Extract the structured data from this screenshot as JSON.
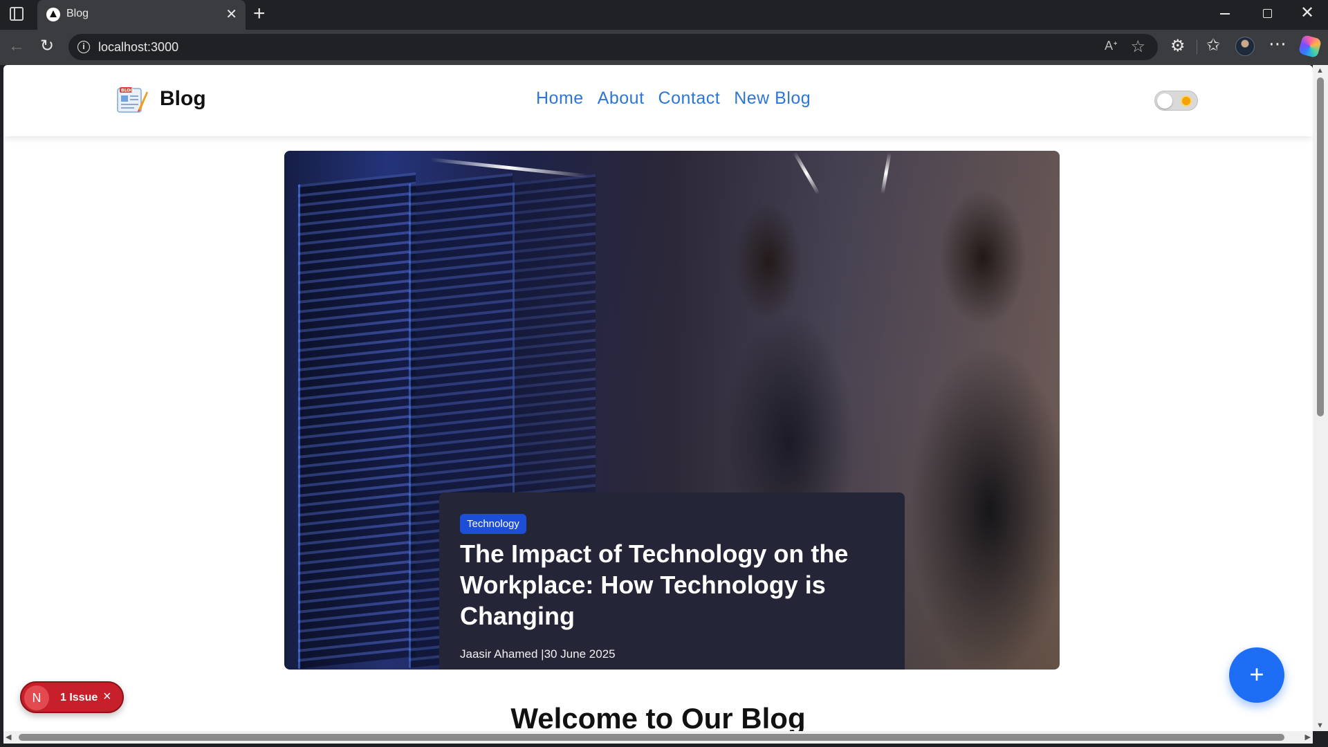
{
  "browser": {
    "tab_title": "Blog",
    "url": "localhost:3000",
    "icons": [
      "sidebar-icon",
      "close-icon",
      "plus-icon",
      "back-icon",
      "reload-icon",
      "info-icon",
      "read-aloud-icon",
      "star-icon",
      "extensions-icon",
      "favorites-icon",
      "more-icon",
      "copilot-icon"
    ]
  },
  "header": {
    "logo_text": "Blog",
    "nav": [
      "Home",
      "About",
      "Contact",
      "New Blog"
    ],
    "theme_toggle": "light"
  },
  "hero": {
    "category": "Technology",
    "title": "The Impact of Technology on the Workplace: How Technology is Changing",
    "meta": "Jaasir Ahamed |30 June 2025"
  },
  "section": {
    "title": "Welcome to Our Blog"
  },
  "fab": {
    "label": "+"
  },
  "dev_overlay": {
    "logo_letter": "N",
    "issue_text": "1 Issue",
    "close": "×"
  },
  "colors": {
    "accent": "#2d76d6",
    "fab": "#1d6ef5",
    "badge": "#1d4ed8",
    "card": "#242536",
    "issue_badge": "#c8202a"
  }
}
